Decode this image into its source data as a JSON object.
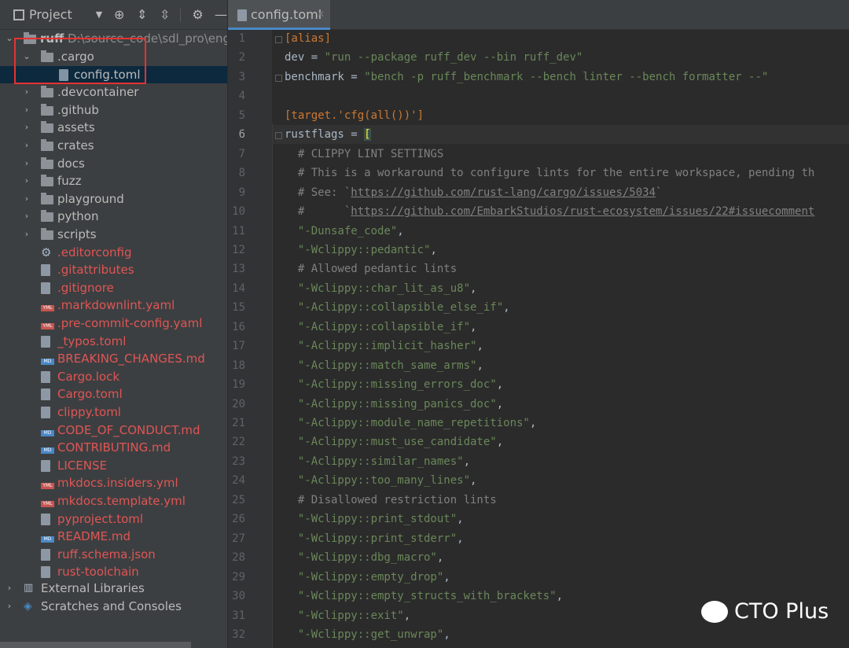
{
  "project_panel": {
    "title": "Project",
    "root": {
      "name": "ruff",
      "path": "D:\\source_code\\sdl_pro\\engin"
    },
    "items": [
      {
        "label": ".cargo",
        "type": "folder",
        "expanded": true,
        "color": "normal"
      },
      {
        "label": "config.toml",
        "type": "toml",
        "color": "normal",
        "selected": true
      },
      {
        "label": ".devcontainer",
        "type": "folder",
        "color": "normal"
      },
      {
        "label": ".github",
        "type": "folder",
        "color": "normal"
      },
      {
        "label": "assets",
        "type": "folder",
        "color": "normal"
      },
      {
        "label": "crates",
        "type": "folder",
        "color": "normal"
      },
      {
        "label": "docs",
        "type": "folder",
        "color": "normal"
      },
      {
        "label": "fuzz",
        "type": "folder",
        "color": "normal"
      },
      {
        "label": "playground",
        "type": "folder",
        "color": "normal"
      },
      {
        "label": "python",
        "type": "folder",
        "color": "normal"
      },
      {
        "label": "scripts",
        "type": "folder",
        "color": "normal"
      },
      {
        "label": ".editorconfig",
        "type": "gear",
        "color": "red"
      },
      {
        "label": ".gitattributes",
        "type": "text",
        "color": "red"
      },
      {
        "label": ".gitignore",
        "type": "text",
        "color": "red"
      },
      {
        "label": ".markdownlint.yaml",
        "type": "yml",
        "color": "red"
      },
      {
        "label": ".pre-commit-config.yaml",
        "type": "yml",
        "color": "red"
      },
      {
        "label": "_typos.toml",
        "type": "toml",
        "color": "red"
      },
      {
        "label": "BREAKING_CHANGES.md",
        "type": "md",
        "color": "red"
      },
      {
        "label": "Cargo.lock",
        "type": "toml",
        "color": "red"
      },
      {
        "label": "Cargo.toml",
        "type": "toml",
        "color": "red"
      },
      {
        "label": "clippy.toml",
        "type": "toml",
        "color": "red"
      },
      {
        "label": "CODE_OF_CONDUCT.md",
        "type": "md",
        "color": "red"
      },
      {
        "label": "CONTRIBUTING.md",
        "type": "md",
        "color": "red"
      },
      {
        "label": "LICENSE",
        "type": "text",
        "color": "red"
      },
      {
        "label": "mkdocs.insiders.yml",
        "type": "yml",
        "color": "red"
      },
      {
        "label": "mkdocs.template.yml",
        "type": "yml",
        "color": "red"
      },
      {
        "label": "pyproject.toml",
        "type": "toml",
        "color": "red"
      },
      {
        "label": "README.md",
        "type": "md",
        "color": "red"
      },
      {
        "label": "ruff.schema.json",
        "type": "text",
        "color": "red"
      },
      {
        "label": "rust-toolchain",
        "type": "text",
        "color": "red"
      }
    ],
    "external_libraries": "External Libraries",
    "scratches": "Scratches and Consoles",
    "toolbar_icons": [
      "locate-icon",
      "expand-all-icon",
      "collapse-all-icon",
      "settings-icon",
      "hide-icon"
    ]
  },
  "editor": {
    "tab_label": "config.toml",
    "current_line": 6,
    "lines": [
      {
        "n": "1",
        "t": "[alias]",
        "k": "section"
      },
      {
        "n": "2",
        "t": "dev = \"run --package ruff_dev --bin ruff_dev\"",
        "k": "kv",
        "key": "dev",
        "val": "\"run --package ruff_dev --bin ruff_dev\""
      },
      {
        "n": "3",
        "t": "benchmark = \"bench -p ruff_benchmark --bench linter --bench formatter --\"",
        "k": "kv",
        "key": "benchmark",
        "val": "\"bench -p ruff_benchmark --bench linter --bench formatter --\""
      },
      {
        "n": "4",
        "t": "",
        "k": "blank"
      },
      {
        "n": "5",
        "t": "[target.'cfg(all())']",
        "k": "section"
      },
      {
        "n": "6",
        "t": "rustflags = [",
        "k": "kvbr",
        "key": "rustflags"
      },
      {
        "n": "7",
        "t": "  # CLIPPY LINT SETTINGS",
        "k": "comment"
      },
      {
        "n": "8",
        "t": "  # This is a workaround to configure lints for the entire workspace, pending th",
        "k": "comment"
      },
      {
        "n": "9",
        "t": "  # See: `https://github.com/rust-lang/cargo/issues/5034`",
        "k": "link",
        "pre": "  # See: `",
        "url": "https://github.com/rust-lang/cargo/issues/5034",
        "post": "`"
      },
      {
        "n": "10",
        "t": "  #      `https://github.com/EmbarkStudios/rust-ecosystem/issues/22#issuecomment",
        "k": "link",
        "pre": "  #      `",
        "url": "https://github.com/EmbarkStudios/rust-ecosystem/issues/22#issuecomment",
        "post": ""
      },
      {
        "n": "11",
        "t": "  \"-Dunsafe_code\",",
        "k": "string"
      },
      {
        "n": "12",
        "t": "  \"-Wclippy::pedantic\",",
        "k": "string"
      },
      {
        "n": "13",
        "t": "  # Allowed pedantic lints",
        "k": "comment"
      },
      {
        "n": "14",
        "t": "  \"-Wclippy::char_lit_as_u8\",",
        "k": "string"
      },
      {
        "n": "15",
        "t": "  \"-Aclippy::collapsible_else_if\",",
        "k": "string"
      },
      {
        "n": "16",
        "t": "  \"-Aclippy::collapsible_if\",",
        "k": "string"
      },
      {
        "n": "17",
        "t": "  \"-Aclippy::implicit_hasher\",",
        "k": "string"
      },
      {
        "n": "18",
        "t": "  \"-Aclippy::match_same_arms\",",
        "k": "string"
      },
      {
        "n": "19",
        "t": "  \"-Aclippy::missing_errors_doc\",",
        "k": "string"
      },
      {
        "n": "20",
        "t": "  \"-Aclippy::missing_panics_doc\",",
        "k": "string"
      },
      {
        "n": "21",
        "t": "  \"-Aclippy::module_name_repetitions\",",
        "k": "string"
      },
      {
        "n": "22",
        "t": "  \"-Aclippy::must_use_candidate\",",
        "k": "string"
      },
      {
        "n": "23",
        "t": "  \"-Aclippy::similar_names\",",
        "k": "string"
      },
      {
        "n": "24",
        "t": "  \"-Aclippy::too_many_lines\",",
        "k": "string"
      },
      {
        "n": "25",
        "t": "  # Disallowed restriction lints",
        "k": "comment"
      },
      {
        "n": "26",
        "t": "  \"-Wclippy::print_stdout\",",
        "k": "string"
      },
      {
        "n": "27",
        "t": "  \"-Wclippy::print_stderr\",",
        "k": "string"
      },
      {
        "n": "28",
        "t": "  \"-Wclippy::dbg_macro\",",
        "k": "string"
      },
      {
        "n": "29",
        "t": "  \"-Wclippy::empty_drop\",",
        "k": "string"
      },
      {
        "n": "30",
        "t": "  \"-Wclippy::empty_structs_with_brackets\",",
        "k": "string"
      },
      {
        "n": "31",
        "t": "  \"-Wclippy::exit\",",
        "k": "string"
      },
      {
        "n": "32",
        "t": "  \"-Wclippy::get_unwrap\",",
        "k": "string"
      }
    ]
  },
  "watermark": {
    "text": "CTO Plus"
  },
  "colors": {
    "sidebar_bg": "#3c3f41",
    "editor_bg": "#2b2b2b",
    "section": "#cc7832",
    "string": "#6a8759",
    "comment": "#808080",
    "modified_file": "#e05555",
    "highlight_box": "#e8312f"
  }
}
